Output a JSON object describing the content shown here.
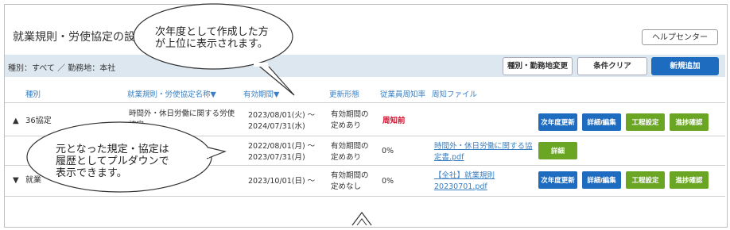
{
  "header": {
    "title": "就業規則・労使協定の設定",
    "help_label": "ヘルプセンター"
  },
  "filter": {
    "text": "種別：すべて ／ 勤務地：本社",
    "change_label": "種別・勤務地変更",
    "clear_label": "条件クリア",
    "add_label": "新規追加"
  },
  "table": {
    "columns": {
      "type": "種別",
      "name": "就業規則・労使協定名称▼",
      "period": "有効期間▼",
      "renewal": "更新形態",
      "rate": "従業員周知率",
      "file": "周知ファイル"
    },
    "rows": [
      {
        "toggle": "▲",
        "type": "36協定",
        "name": "時間外・休日労働に関する労使",
        "name2": "協定",
        "period1": "2023/08/01(火) ～",
        "period2": "2024/07/31(水)",
        "renewal1": "有効期間の",
        "renewal2": "定めあり",
        "rate": "",
        "status": "周知前",
        "file1": "",
        "file2": "",
        "buttons": [
          "次年度更新",
          "詳細/編集",
          "工程設定",
          "進捗確認"
        ]
      },
      {
        "toggle": "",
        "type": "",
        "name": "",
        "name2": "",
        "period1": "2022/08/01(月) ～",
        "period2": "2023/07/31(月)",
        "renewal1": "有効期間の",
        "renewal2": "定めあり",
        "rate": "0%",
        "status": "",
        "file1": "時間外・休日労働に関する協",
        "file2": "定書.pdf",
        "buttons": [
          "詳細"
        ]
      },
      {
        "toggle": "▼",
        "type": "就業",
        "name": "",
        "name2": "",
        "period1": "2023/10/01(日) ～",
        "period2": "",
        "renewal1": "有効期間の",
        "renewal2": "定めなし",
        "rate": "0%",
        "status": "",
        "file1": "【全社】就業規則",
        "file2": "20230701.pdf",
        "buttons": [
          "次年度更新",
          "詳細/編集",
          "工程設定",
          "進捗確認"
        ]
      }
    ]
  },
  "callouts": {
    "top": [
      "次年度として作成した方",
      "が上位に表示されます。"
    ],
    "bottom": [
      "元となった規定・協定は",
      "履歴としてプルダウンで",
      "表示できます。"
    ]
  },
  "colors": {
    "accent_blue": "#1e6cc0",
    "action_green": "#6aa524",
    "status_red": "#d0102e",
    "filter_bar": "#dce7f0",
    "header_link": "#3a7fc1"
  }
}
